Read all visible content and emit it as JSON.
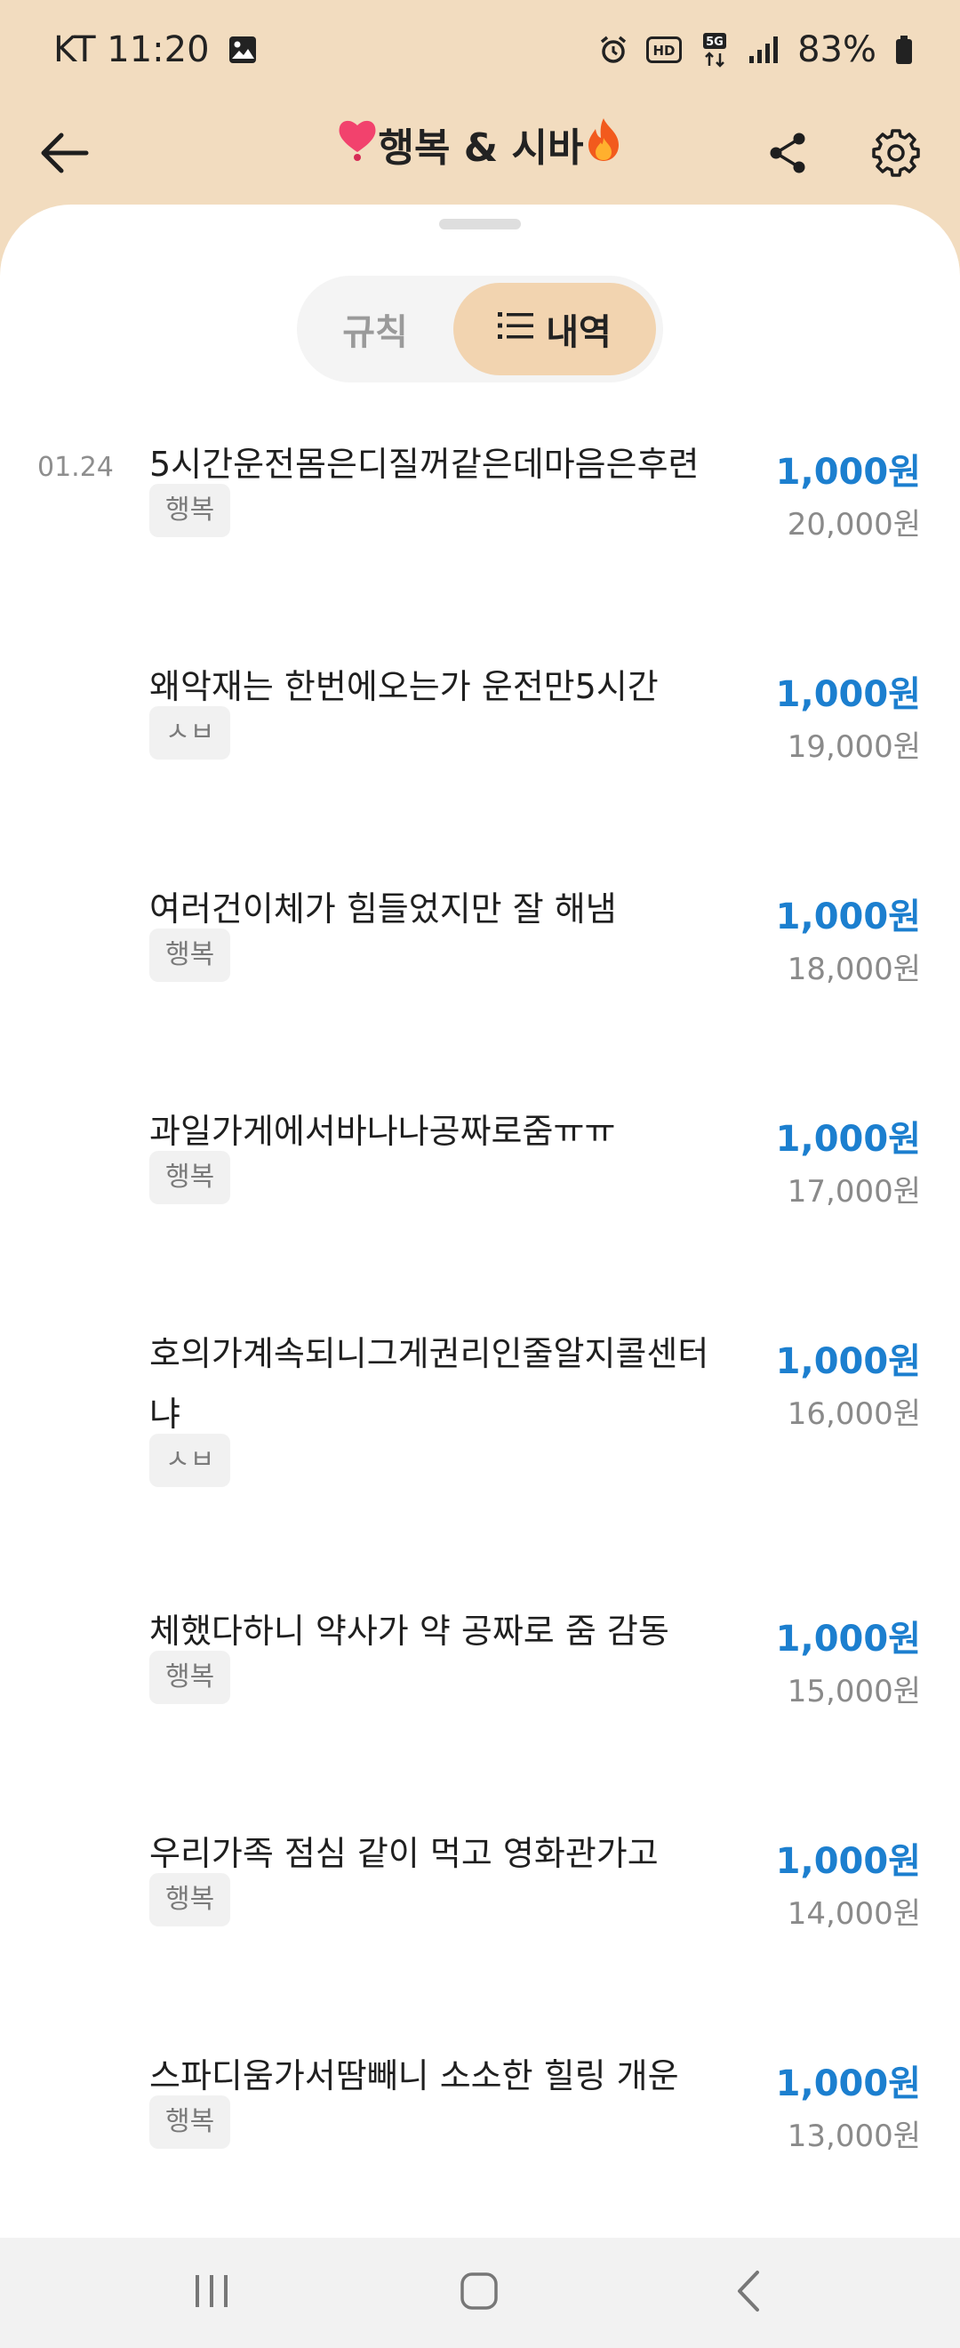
{
  "status_bar": {
    "carrier_time": "KT 11:20",
    "network": "5G",
    "battery": "83%"
  },
  "header": {
    "title": "행복 & 시바",
    "title_prefix_icon": "heart-icon",
    "title_suffix_icon": "fire-icon",
    "back_icon": "arrow-left-icon",
    "share_icon": "share-icon",
    "settings_icon": "gear-icon"
  },
  "tabs": {
    "rules": "규칙",
    "history": "내역",
    "history_icon": "list-icon"
  },
  "entries": [
    {
      "date": "01.24",
      "text": "5시간운전몸은디질꺼같은데마음은후련",
      "tag": "행복",
      "amount": "1,000원",
      "balance": "20,000원"
    },
    {
      "date": "",
      "text": "왜악재는 한번에오는가 운전만5시간",
      "tag": "ㅅㅂ",
      "amount": "1,000원",
      "balance": "19,000원"
    },
    {
      "date": "",
      "text": "여러건이체가 힘들었지만 잘 해냄",
      "tag": "행복",
      "amount": "1,000원",
      "balance": "18,000원"
    },
    {
      "date": "",
      "text": "과일가게에서바나나공짜로줌ㅠㅠ",
      "tag": "행복",
      "amount": "1,000원",
      "balance": "17,000원"
    },
    {
      "date": "",
      "text": "호의가계속되니그게권리인줄알지콜센터냐",
      "tag": "ㅅㅂ",
      "amount": "1,000원",
      "balance": "16,000원"
    },
    {
      "date": "",
      "text": "체했다하니 약사가 약 공짜로 줌 감동",
      "tag": "행복",
      "amount": "1,000원",
      "balance": "15,000원"
    },
    {
      "date": "",
      "text": "우리가족 점심 같이 먹고 영화관가고",
      "tag": "행복",
      "amount": "1,000원",
      "balance": "14,000원"
    },
    {
      "date": "",
      "text": "스파디움가서땀빼니 소소한 힐링 개운",
      "tag": "행복",
      "amount": "1,000원",
      "balance": "13,000원"
    }
  ],
  "colors": {
    "accent_blue": "#1c7fcf",
    "header_bg": "#f2dcbf",
    "tab_active": "#f2d4b0"
  }
}
